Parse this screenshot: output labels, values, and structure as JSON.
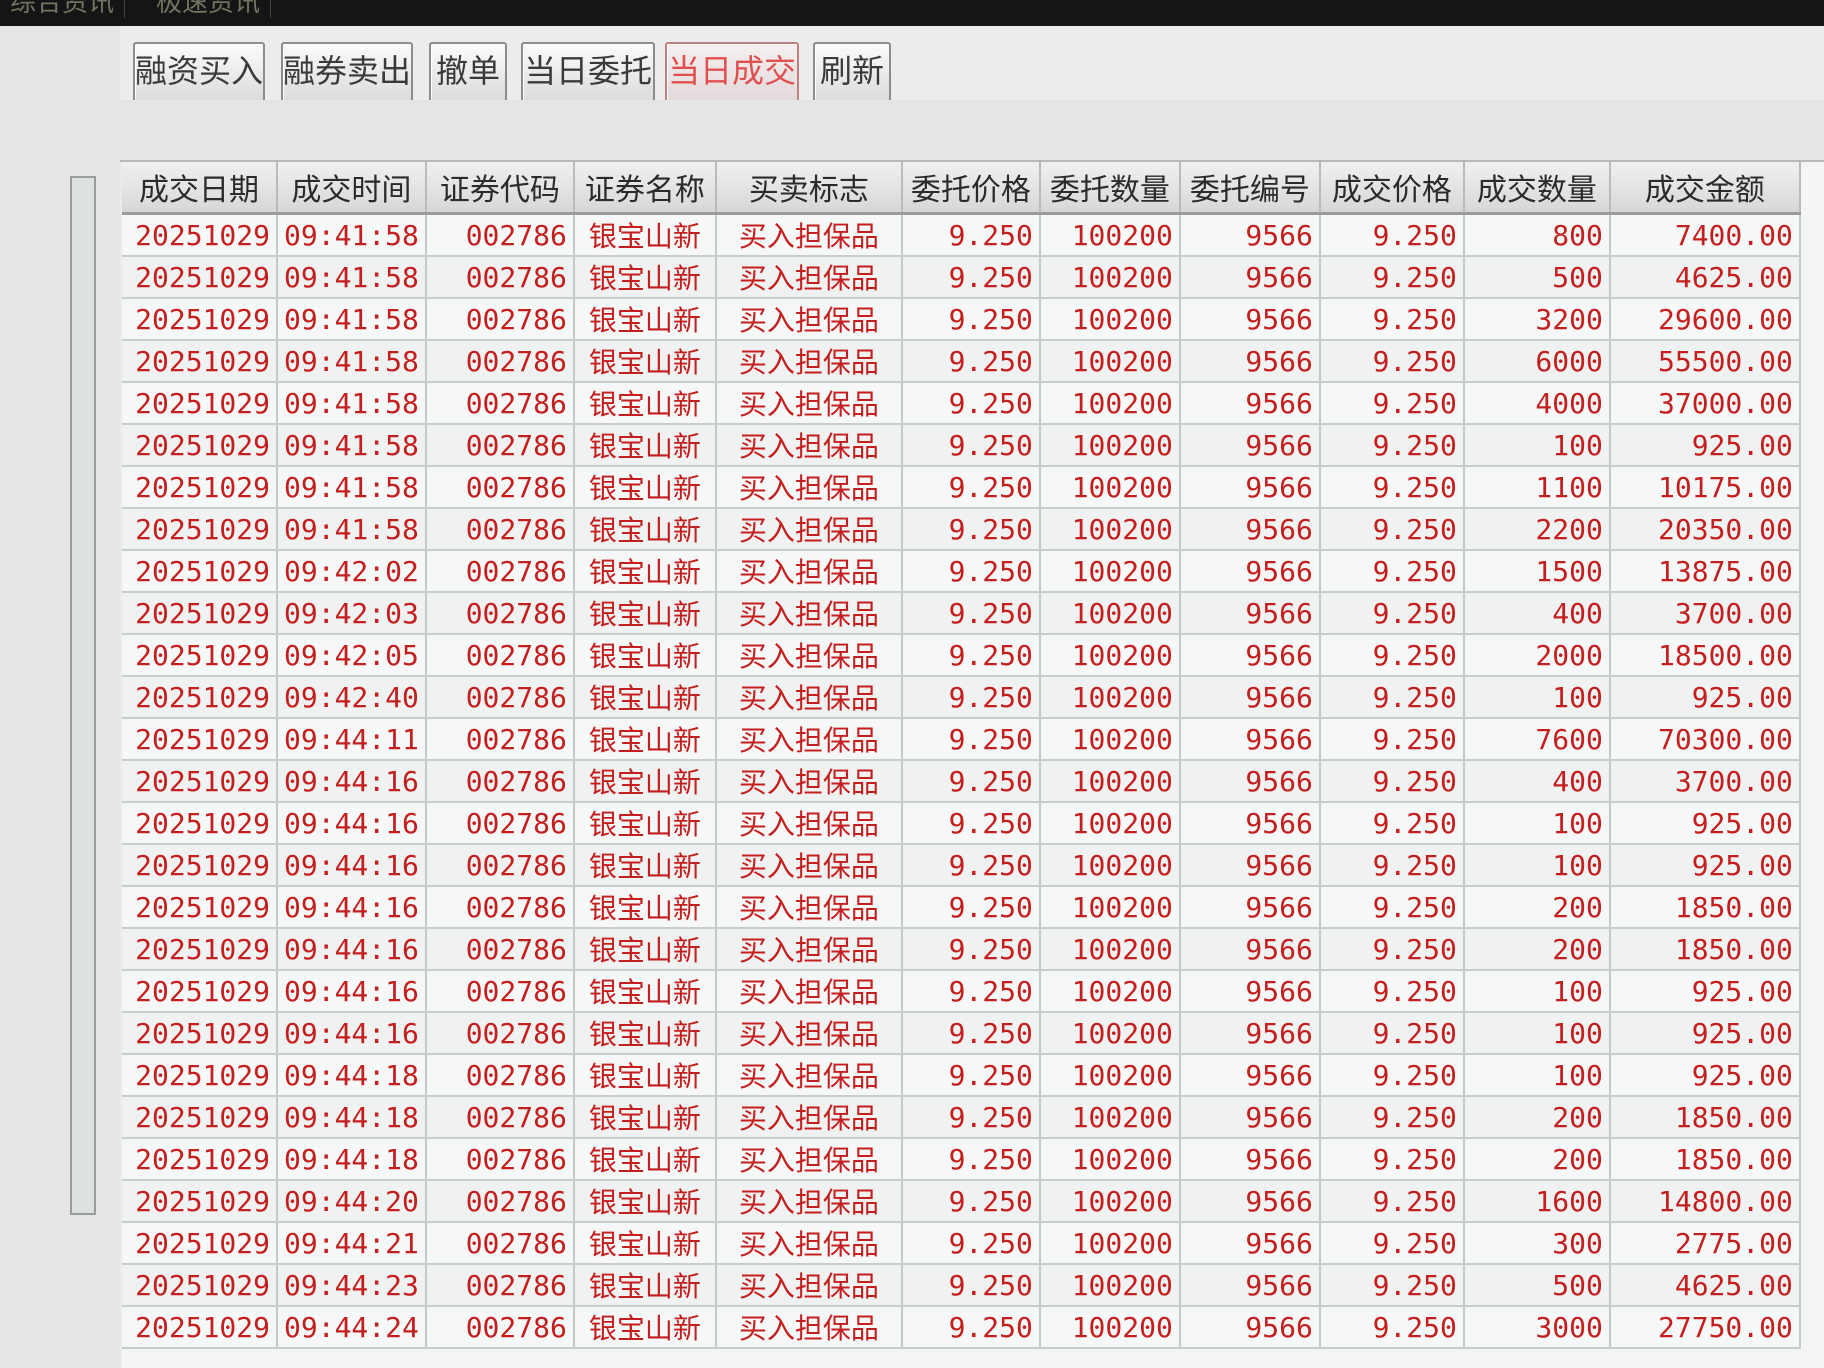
{
  "top_tabs": [
    "综合资讯",
    "极速资讯"
  ],
  "toolbar": {
    "buttons": [
      {
        "label": "融资买入",
        "active": false
      },
      {
        "label": "融券卖出",
        "active": false
      },
      {
        "label": "撤单",
        "active": false
      },
      {
        "label": "当日委托",
        "active": false
      },
      {
        "label": "当日成交",
        "active": true
      },
      {
        "label": "刷新",
        "active": false
      }
    ]
  },
  "table": {
    "columns": [
      "成交日期",
      "成交时间",
      "证券代码",
      "证券名称",
      "买卖标志",
      "委托价格",
      "委托数量",
      "委托编号",
      "成交价格",
      "成交数量",
      "成交金额"
    ],
    "rows": [
      [
        "20251029",
        "09:41:58",
        "002786",
        "银宝山新",
        "买入担保品",
        "9.250",
        "100200",
        "9566",
        "9.250",
        "800",
        "7400.00"
      ],
      [
        "20251029",
        "09:41:58",
        "002786",
        "银宝山新",
        "买入担保品",
        "9.250",
        "100200",
        "9566",
        "9.250",
        "500",
        "4625.00"
      ],
      [
        "20251029",
        "09:41:58",
        "002786",
        "银宝山新",
        "买入担保品",
        "9.250",
        "100200",
        "9566",
        "9.250",
        "3200",
        "29600.00"
      ],
      [
        "20251029",
        "09:41:58",
        "002786",
        "银宝山新",
        "买入担保品",
        "9.250",
        "100200",
        "9566",
        "9.250",
        "6000",
        "55500.00"
      ],
      [
        "20251029",
        "09:41:58",
        "002786",
        "银宝山新",
        "买入担保品",
        "9.250",
        "100200",
        "9566",
        "9.250",
        "4000",
        "37000.00"
      ],
      [
        "20251029",
        "09:41:58",
        "002786",
        "银宝山新",
        "买入担保品",
        "9.250",
        "100200",
        "9566",
        "9.250",
        "100",
        "925.00"
      ],
      [
        "20251029",
        "09:41:58",
        "002786",
        "银宝山新",
        "买入担保品",
        "9.250",
        "100200",
        "9566",
        "9.250",
        "1100",
        "10175.00"
      ],
      [
        "20251029",
        "09:41:58",
        "002786",
        "银宝山新",
        "买入担保品",
        "9.250",
        "100200",
        "9566",
        "9.250",
        "2200",
        "20350.00"
      ],
      [
        "20251029",
        "09:42:02",
        "002786",
        "银宝山新",
        "买入担保品",
        "9.250",
        "100200",
        "9566",
        "9.250",
        "1500",
        "13875.00"
      ],
      [
        "20251029",
        "09:42:03",
        "002786",
        "银宝山新",
        "买入担保品",
        "9.250",
        "100200",
        "9566",
        "9.250",
        "400",
        "3700.00"
      ],
      [
        "20251029",
        "09:42:05",
        "002786",
        "银宝山新",
        "买入担保品",
        "9.250",
        "100200",
        "9566",
        "9.250",
        "2000",
        "18500.00"
      ],
      [
        "20251029",
        "09:42:40",
        "002786",
        "银宝山新",
        "买入担保品",
        "9.250",
        "100200",
        "9566",
        "9.250",
        "100",
        "925.00"
      ],
      [
        "20251029",
        "09:44:11",
        "002786",
        "银宝山新",
        "买入担保品",
        "9.250",
        "100200",
        "9566",
        "9.250",
        "7600",
        "70300.00"
      ],
      [
        "20251029",
        "09:44:16",
        "002786",
        "银宝山新",
        "买入担保品",
        "9.250",
        "100200",
        "9566",
        "9.250",
        "400",
        "3700.00"
      ],
      [
        "20251029",
        "09:44:16",
        "002786",
        "银宝山新",
        "买入担保品",
        "9.250",
        "100200",
        "9566",
        "9.250",
        "100",
        "925.00"
      ],
      [
        "20251029",
        "09:44:16",
        "002786",
        "银宝山新",
        "买入担保品",
        "9.250",
        "100200",
        "9566",
        "9.250",
        "100",
        "925.00"
      ],
      [
        "20251029",
        "09:44:16",
        "002786",
        "银宝山新",
        "买入担保品",
        "9.250",
        "100200",
        "9566",
        "9.250",
        "200",
        "1850.00"
      ],
      [
        "20251029",
        "09:44:16",
        "002786",
        "银宝山新",
        "买入担保品",
        "9.250",
        "100200",
        "9566",
        "9.250",
        "200",
        "1850.00"
      ],
      [
        "20251029",
        "09:44:16",
        "002786",
        "银宝山新",
        "买入担保品",
        "9.250",
        "100200",
        "9566",
        "9.250",
        "100",
        "925.00"
      ],
      [
        "20251029",
        "09:44:16",
        "002786",
        "银宝山新",
        "买入担保品",
        "9.250",
        "100200",
        "9566",
        "9.250",
        "100",
        "925.00"
      ],
      [
        "20251029",
        "09:44:18",
        "002786",
        "银宝山新",
        "买入担保品",
        "9.250",
        "100200",
        "9566",
        "9.250",
        "100",
        "925.00"
      ],
      [
        "20251029",
        "09:44:18",
        "002786",
        "银宝山新",
        "买入担保品",
        "9.250",
        "100200",
        "9566",
        "9.250",
        "200",
        "1850.00"
      ],
      [
        "20251029",
        "09:44:18",
        "002786",
        "银宝山新",
        "买入担保品",
        "9.250",
        "100200",
        "9566",
        "9.250",
        "200",
        "1850.00"
      ],
      [
        "20251029",
        "09:44:20",
        "002786",
        "银宝山新",
        "买入担保品",
        "9.250",
        "100200",
        "9566",
        "9.250",
        "1600",
        "14800.00"
      ],
      [
        "20251029",
        "09:44:21",
        "002786",
        "银宝山新",
        "买入担保品",
        "9.250",
        "100200",
        "9566",
        "9.250",
        "300",
        "2775.00"
      ],
      [
        "20251029",
        "09:44:23",
        "002786",
        "银宝山新",
        "买入担保品",
        "9.250",
        "100200",
        "9566",
        "9.250",
        "500",
        "4625.00"
      ],
      [
        "20251029",
        "09:44:24",
        "002786",
        "银宝山新",
        "买入担保品",
        "9.250",
        "100200",
        "9566",
        "9.250",
        "3000",
        "27750.00"
      ]
    ]
  },
  "colors": {
    "cell_text": "#c41e1e",
    "active_button_text": "#e05050",
    "topbar_bg": "#151515"
  }
}
